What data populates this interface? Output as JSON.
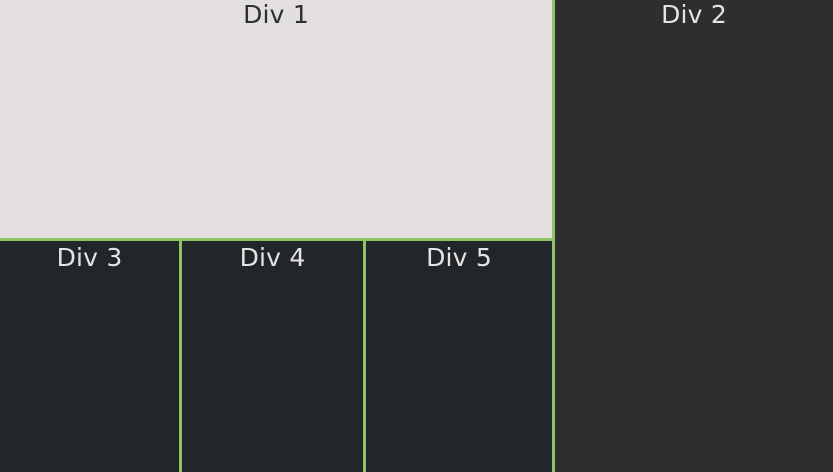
{
  "panels": {
    "div1": {
      "label": "Div 1"
    },
    "div2": {
      "label": "Div 2"
    },
    "div3": {
      "label": "Div 3"
    },
    "div4": {
      "label": "Div 4"
    },
    "div5": {
      "label": "Div 5"
    }
  },
  "colors": {
    "border_accent": "#8dc466",
    "div1_background": "#e2dfde",
    "div2_background": "#2e2e2e",
    "bottom_background": "#232629",
    "light_text": "#e4e4e4",
    "dark_text": "#2c3033"
  }
}
